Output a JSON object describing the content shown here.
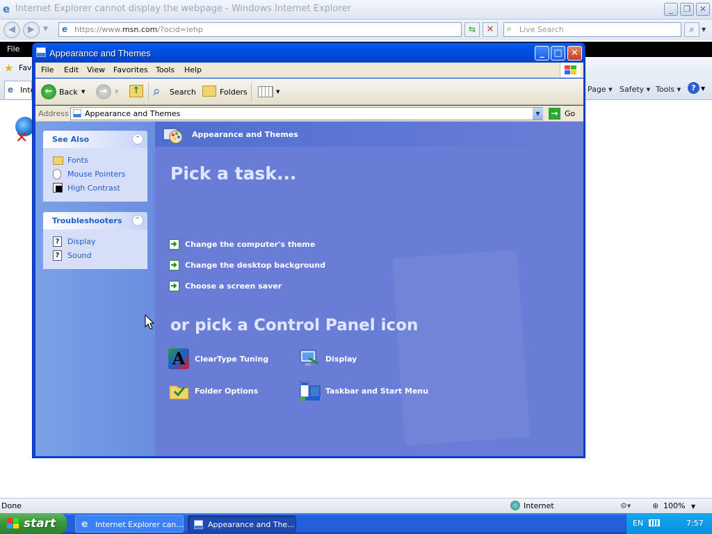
{
  "ie": {
    "title": "Internet Explorer cannot display the webpage - Windows Internet Explorer",
    "url_prefix": "https://www.",
    "url_host": "msn.com",
    "url_rest": "/?ocid=iehp",
    "search_placeholder": "Live Search",
    "menu_file": "File",
    "fav_label": "Fav",
    "tab_label": "Inte",
    "cmd_page": "Page ▾",
    "cmd_safety": "Safety ▾",
    "cmd_tools": "Tools ▾",
    "status_done": "Done",
    "status_zone": "Internet",
    "status_zoom": "100%"
  },
  "window": {
    "title": "Appearance and Themes",
    "menu": [
      "File",
      "Edit",
      "View",
      "Favorites",
      "Tools",
      "Help"
    ],
    "toolbar": {
      "back": "Back",
      "search": "Search",
      "folders": "Folders"
    },
    "address_label": "Address",
    "address_value": "Appearance and Themes",
    "go_label": "Go",
    "header": "Appearance and Themes",
    "see_also": {
      "title": "See Also",
      "items": [
        "Fonts",
        "Mouse Pointers",
        "High Contrast"
      ]
    },
    "troubleshooters": {
      "title": "Troubleshooters",
      "items": [
        "Display",
        "Sound"
      ]
    },
    "pick_task": "Pick a task...",
    "tasks": [
      "Change the computer's theme",
      "Change the desktop background",
      "Choose a screen saver"
    ],
    "pick_icon": "or pick a Control Panel icon",
    "icons": [
      "ClearType Tuning",
      "Display",
      "Folder Options",
      "Taskbar and Start Menu"
    ]
  },
  "taskbar": {
    "start": "start",
    "tasks": [
      "Internet Explorer can...",
      "Appearance and The..."
    ],
    "lang": "EN",
    "time": "7:57"
  },
  "colors": {
    "xp_blue": "#0054e3",
    "panel_body": "#6a7dd6",
    "link_blue": "#215dc6"
  }
}
